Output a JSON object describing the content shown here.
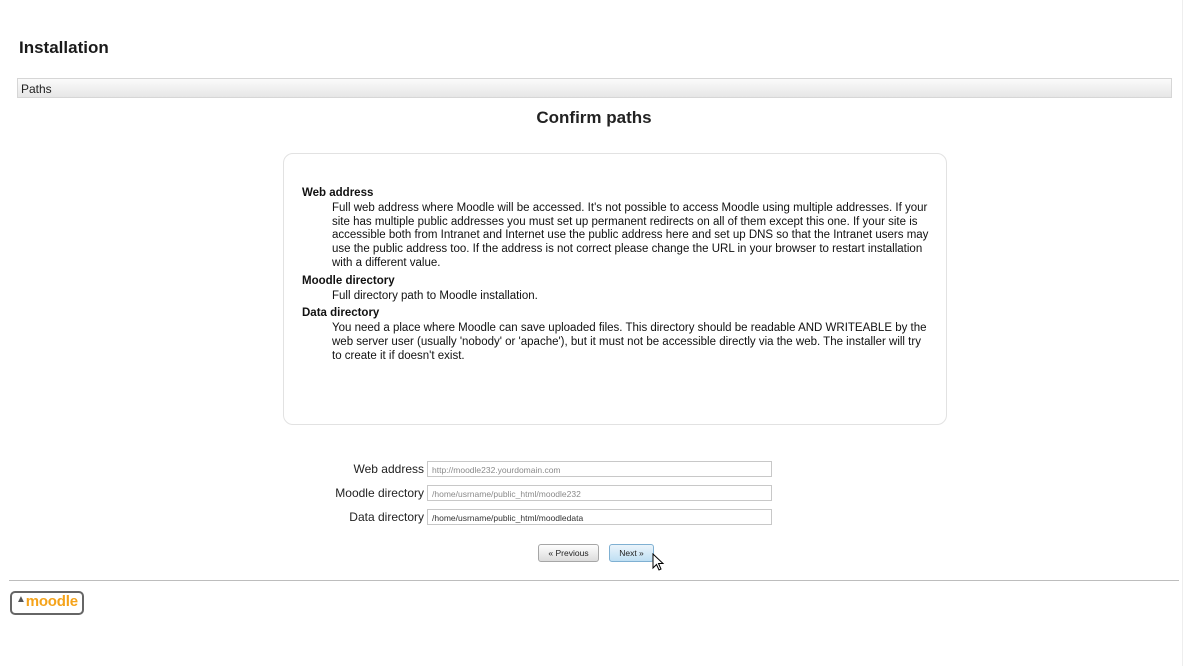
{
  "header": {
    "title": "Installation"
  },
  "nav": {
    "breadcrumb": "Paths"
  },
  "main": {
    "heading": "Confirm paths",
    "help": [
      {
        "term": "Web address",
        "description": "Full web address where Moodle will be accessed. It's not possible to access Moodle using multiple addresses. If your site has multiple public addresses you must set up permanent redirects on all of them except this one. If your site is accessible both from Intranet and Internet use the public address here and set up DNS so that the Intranet users may use the public address too. If the address is not correct please change the URL in your browser to restart installation with a different value."
      },
      {
        "term": "Moodle directory",
        "description": "Full directory path to Moodle installation."
      },
      {
        "term": "Data directory",
        "description": "You need a place where Moodle can save uploaded files. This directory should be readable AND WRITEABLE by the web server user (usually 'nobody' or 'apache'), but it must not be accessible directly via the web. The installer will try to create it if doesn't exist."
      }
    ]
  },
  "form": {
    "web_address": {
      "label": "Web address",
      "value": "http://moodle232.yourdomain.com"
    },
    "moodle_directory": {
      "label": "Moodle directory",
      "value": "/home/usrname/public_html/moodle232"
    },
    "data_directory": {
      "label": "Data directory",
      "value": "/home/usrname/public_html/moodledata"
    }
  },
  "buttons": {
    "previous": "« Previous",
    "next": "Next »"
  },
  "footer": {
    "logo_text": "moodle"
  },
  "icons": {
    "cursor": "mouse-pointer-icon",
    "logo_hat": "graduation-cap-icon"
  },
  "colors": {
    "logo_orange": "#f5a31a",
    "next_button": "#bfdff3"
  }
}
